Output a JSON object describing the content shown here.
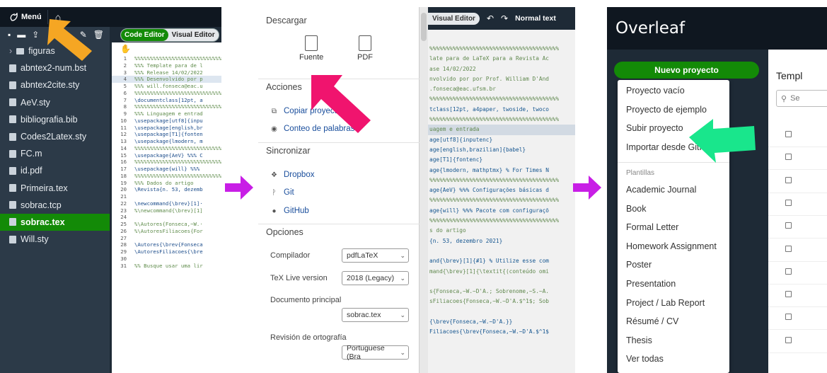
{
  "panel1": {
    "menu_label": "Menú",
    "editor_tabs": [
      "Code Editor",
      "Visual Editor"
    ],
    "files": [
      {
        "name": "figuras",
        "type": "folder"
      },
      {
        "name": "abntex2-num.bst",
        "type": "file"
      },
      {
        "name": "abntex2cite.sty",
        "type": "file"
      },
      {
        "name": "AeV.sty",
        "type": "file"
      },
      {
        "name": "bibliografia.bib",
        "type": "file"
      },
      {
        "name": "Codes2Latex.sty",
        "type": "file"
      },
      {
        "name": "FC.m",
        "type": "file"
      },
      {
        "name": "id.pdf",
        "type": "file"
      },
      {
        "name": "Primeira.tex",
        "type": "file"
      },
      {
        "name": "sobrac.tcp",
        "type": "file"
      },
      {
        "name": "sobrac.tex",
        "type": "file",
        "active": true
      },
      {
        "name": "Will.sty",
        "type": "file"
      }
    ],
    "code_lines": [
      {
        "n": "1",
        "t": "%%%%%%%%%%%%%%%%%%%%%%%%%%%%%%",
        "c": "c"
      },
      {
        "n": "2",
        "t": "%%% Template para de l",
        "c": "c"
      },
      {
        "n": "3",
        "t": "%%% Release 14/02/2022",
        "c": "c"
      },
      {
        "n": "4",
        "t": "%%% Desenvolvido por p",
        "c": "c",
        "hl": true
      },
      {
        "n": "5",
        "t": "%%% will.fonseca@eac.u",
        "c": "c"
      },
      {
        "n": "6",
        "t": "%%%%%%%%%%%%%%%%%%%%%%%%%%%%%%",
        "c": "c"
      },
      {
        "n": "7",
        "t": "\\documentclass[12pt, a",
        "c": "k"
      },
      {
        "n": "8",
        "t": "%%%%%%%%%%%%%%%%%%%%%%%%%%%%%%",
        "c": "c"
      },
      {
        "n": "9",
        "t": "%%% Linguagem e entrad",
        "c": "c"
      },
      {
        "n": "10",
        "t": "\\usepackage[utf8]{inpu",
        "c": "k"
      },
      {
        "n": "11",
        "t": "\\usepackage[english,br",
        "c": "k"
      },
      {
        "n": "12",
        "t": "\\usepackage[T1]{fonten",
        "c": "k"
      },
      {
        "n": "13",
        "t": "\\usepackage{lmodern, m",
        "c": "k"
      },
      {
        "n": "14",
        "t": "%%%%%%%%%%%%%%%%%%%%%%%%%%%%%%",
        "c": "c"
      },
      {
        "n": "15",
        "t": "\\usepackage{AeV} %%% C",
        "c": "k"
      },
      {
        "n": "16",
        "t": "%%%%%%%%%%%%%%%%%%%%%%%%%%%%%%",
        "c": "c"
      },
      {
        "n": "17",
        "t": "\\usepackage{will} %%%",
        "c": "k"
      },
      {
        "n": "18",
        "t": "%%%%%%%%%%%%%%%%%%%%%%%%%%%%%%",
        "c": "c"
      },
      {
        "n": "19",
        "t": "%%% Dados do artigo",
        "c": "c"
      },
      {
        "n": "20",
        "t": "\\Revista{n. 53, dezemb",
        "c": "k"
      },
      {
        "n": "21",
        "t": "",
        "c": "k"
      },
      {
        "n": "22",
        "t": "\\newcommand{\\brev}[1]·",
        "c": "k"
      },
      {
        "n": "23",
        "t": "%\\newcommand{\\brev}[1]",
        "c": "c"
      },
      {
        "n": "24",
        "t": "",
        "c": "k"
      },
      {
        "n": "25",
        "t": "%\\Autores{Fonseca,~W.·",
        "c": "c"
      },
      {
        "n": "26",
        "t": "%\\AutoresFiliacoes{For",
        "c": "c"
      },
      {
        "n": "27",
        "t": "",
        "c": "k"
      },
      {
        "n": "28",
        "t": "\\Autores{\\brev{Fonseca",
        "c": "k"
      },
      {
        "n": "29",
        "t": "\\AutoresFiliacoes{\\bre",
        "c": "k"
      },
      {
        "n": "30",
        "t": "",
        "c": "k"
      },
      {
        "n": "31",
        "t": "%% Busque usar uma lir",
        "c": "c"
      }
    ]
  },
  "panel2": {
    "section_download": "Descargar",
    "download_source": "Fuente",
    "download_pdf": "PDF",
    "section_actions": "Acciones",
    "copy_project": "Copiar proyecto",
    "word_count": "Conteo de palabras",
    "section_sync": "Sincronizar",
    "dropbox": "Dropbox",
    "git": "Git",
    "github": "GitHub",
    "section_options": "Opciones",
    "compiler_label": "Compilador",
    "compiler_value": "pdfLaTeX",
    "texlive_label": "TeX Live version",
    "texlive_value": "2018 (Legacy)",
    "main_doc_label": "Documento principal",
    "main_doc_value": "sobrac.tex",
    "spell_label": "Revisión de ortografía",
    "spell_value": "Portuguese (Bra"
  },
  "panel2_editor": {
    "visual_tab": "Visual Editor",
    "normal_text": "Normal text",
    "lines": [
      {
        "t": "%%%%%%%%%%%%%%%%%%%%%%%%%%%%%%%%%%%%%%%",
        "c": "c"
      },
      {
        "t": "late para de LaTeX para a Revista Ac",
        "c": "c"
      },
      {
        "t": "ase 14/02/2022",
        "c": "c"
      },
      {
        "t": "nvolvido por por Prof. William D'And",
        "c": "c"
      },
      {
        "t": ".fonseca@eac.ufsm.br",
        "c": "c"
      },
      {
        "t": "%%%%%%%%%%%%%%%%%%%%%%%%%%%%%%%%%%%%%%%",
        "c": "c"
      },
      {
        "t": "tclass[12pt, a4paper, twoside, twoco",
        "c": "k"
      },
      {
        "t": "%%%%%%%%%%%%%%%%%%%%%%%%%%%%%%%%%%%%%%%",
        "c": "c"
      },
      {
        "t": "uagem e entrada",
        "c": "c",
        "hl": true
      },
      {
        "t": "age[utf8]{inputenc}",
        "c": "k"
      },
      {
        "t": "age[english,brazilian]{babel}",
        "c": "k"
      },
      {
        "t": "age[T1]{fontenc}",
        "c": "k"
      },
      {
        "t": "age{lmodern, mathptmx} % For Times N",
        "c": "k"
      },
      {
        "t": "%%%%%%%%%%%%%%%%%%%%%%%%%%%%%%%%%%%%%%%",
        "c": "c"
      },
      {
        "t": "age{AeV} %%% Configurações básicas d",
        "c": "k"
      },
      {
        "t": "%%%%%%%%%%%%%%%%%%%%%%%%%%%%%%%%%%%%%%%",
        "c": "c"
      },
      {
        "t": "age{will} %%% Pacote com configuraçõ",
        "c": "k"
      },
      {
        "t": "%%%%%%%%%%%%%%%%%%%%%%%%%%%%%%%%%%%%%%%",
        "c": "c"
      },
      {
        "t": "s do artigo",
        "c": "c"
      },
      {
        "t": "{n. 53, dezembro 2021}",
        "c": "k"
      },
      {
        "t": "",
        "c": "k"
      },
      {
        "t": "and{\\brev}[1]{#1} % Utilize esse com",
        "c": "k"
      },
      {
        "t": "mand{\\brev}[1]{\\textit{(conteúdo omi",
        "c": "c"
      },
      {
        "t": "",
        "c": "k"
      },
      {
        "t": "s{Fonseca,~W.~D'A.; Sobrenome,~S.~A.",
        "c": "c"
      },
      {
        "t": "sFiliacoes{Fonseca,~W.~D'A.$^1$; Sob",
        "c": "c"
      },
      {
        "t": "",
        "c": "k"
      },
      {
        "t": "{\\brev{Fonseca,~W.~D'A.}}",
        "c": "k"
      },
      {
        "t": "Filiacoes{\\brev{Fonseca,~W.~D'A.$^1$",
        "c": "k"
      }
    ]
  },
  "panel3": {
    "logo": "Overleaf",
    "new_project": "Nuevo proyecto",
    "menu_items": [
      "Proyecto vacío",
      "Proyecto de ejemplo",
      "Subir proyecto",
      "Importar desde GitH"
    ],
    "templates_heading": "Plantillas",
    "template_items": [
      "Academic Journal",
      "Book",
      "Formal Letter",
      "Homework Assignment",
      "Poster",
      "Presentation",
      "Project / Lab Report",
      "Résumé / CV",
      "Thesis",
      "Ver todas"
    ],
    "main_title": "Templ",
    "search_placeholder": "Se"
  },
  "colors": {
    "arrow_orange": "#f5a623",
    "arrow_pink": "#f0146e",
    "arrow_green": "#19e68c",
    "arrow_purple": "#c81ee6",
    "overleaf_green": "#138a07"
  }
}
